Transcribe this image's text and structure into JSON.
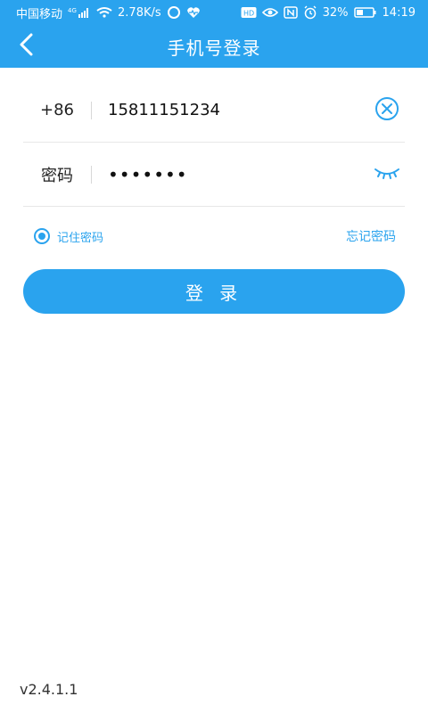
{
  "statusbar": {
    "carrier": "中国移动",
    "network": "4G",
    "speed": "2.78K/s",
    "battery": "32%",
    "time": "14:19"
  },
  "appbar": {
    "title": "手机号登录",
    "back_icon": "chevron-left-icon"
  },
  "form": {
    "phone": {
      "prefix": "+86",
      "value": "15811151234",
      "clear_icon": "clear-circle-x-icon"
    },
    "password": {
      "label": "密码",
      "masked_value": "•••••••",
      "toggle_icon": "eye-closed-icon"
    }
  },
  "options": {
    "remember_label": "记住密码",
    "remember_checked": true,
    "forgot_label": "忘记密码"
  },
  "actions": {
    "login_label": "登 录"
  },
  "footer": {
    "version": "v2.4.1.1"
  },
  "colors": {
    "primary": "#2aa3ee",
    "divider": "#e7e7e7"
  }
}
